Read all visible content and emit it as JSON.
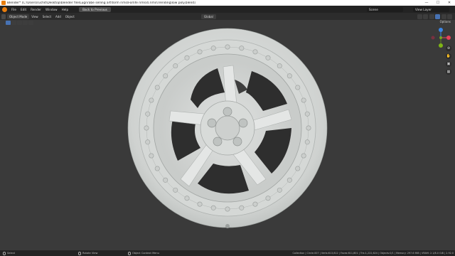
{
  "window": {
    "title": "Blender* [C:\\Users\\ruchit\\Desktop\\blender file\\Lugi\\rabe selling art\\form rims\\Forlife rims\\4.rims\\Trending\\low poly.blend]",
    "minimize": "—",
    "maximize": "☐",
    "close": "✕"
  },
  "menu": {
    "items": [
      "File",
      "Edit",
      "Render",
      "Window",
      "Help"
    ],
    "workspace_tab": "Back to Previous",
    "scene": "Scene",
    "view_layer": "View Layer"
  },
  "header": {
    "mode": "Object Mode",
    "menus": [
      "View",
      "Select",
      "Add",
      "Object"
    ],
    "transform_orientation": "Global",
    "options": "Options"
  },
  "gizmo": {
    "axes": [
      "X",
      "Y",
      "Z"
    ],
    "colors": {
      "x": "#e8415a",
      "y": "#7fb515",
      "z": "#3b86e6"
    }
  },
  "nav_icons": [
    "zoom-icon",
    "hand-icon",
    "camera-icon",
    "grid-icon"
  ],
  "status": {
    "hints": [
      "Select",
      "Rotate View",
      "Object Context Menu"
    ],
    "info": "Collection | Circle.007 | Verts:613,812 | Faces:611,801 | Tris:1,222,624 | Objects:0/1 | Memory: 297.6 MiB | VRAM: 2.1/8.0 GiB | 2.92.0"
  },
  "colors": {
    "accent": "#4772b3",
    "viewport": "#3a3a3a",
    "wheel": "#dcdedd"
  }
}
